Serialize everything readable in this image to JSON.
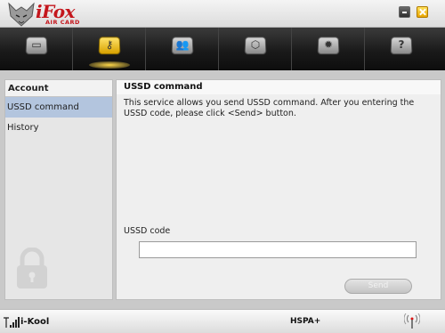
{
  "app": {
    "logo_brand": "iFox",
    "logo_sub": "AIR CARD"
  },
  "window_controls": {
    "minimize_icon": "minimize-icon",
    "close_icon": "close-icon"
  },
  "toolbar": {
    "tabs": [
      {
        "icon": "monitor-icon",
        "glyph": "▭",
        "active": false
      },
      {
        "icon": "key-icon",
        "glyph": "⚷",
        "active": true
      },
      {
        "icon": "contacts-icon",
        "glyph": "👥",
        "active": false
      },
      {
        "icon": "box-icon",
        "glyph": "⬡",
        "active": false
      },
      {
        "icon": "settings-icon",
        "glyph": "✹",
        "active": false
      },
      {
        "icon": "help-icon",
        "glyph": "?",
        "active": false
      }
    ]
  },
  "sidebar": {
    "title": "Account",
    "items": [
      {
        "label": "USSD command",
        "selected": true
      },
      {
        "label": "History",
        "selected": false
      }
    ]
  },
  "main": {
    "title": "USSD command",
    "description": "This service allows you send USSD command. After you entering the USSD code, please click <Send> button.",
    "code_label": "USSD code",
    "code_value": "",
    "send_label": "Send"
  },
  "status": {
    "operator": "i-Kool",
    "network": "HSPA+"
  },
  "colors": {
    "brand": "#c4161c",
    "selected_item": "#b3c5de",
    "active_tab": "#f2c21a"
  }
}
